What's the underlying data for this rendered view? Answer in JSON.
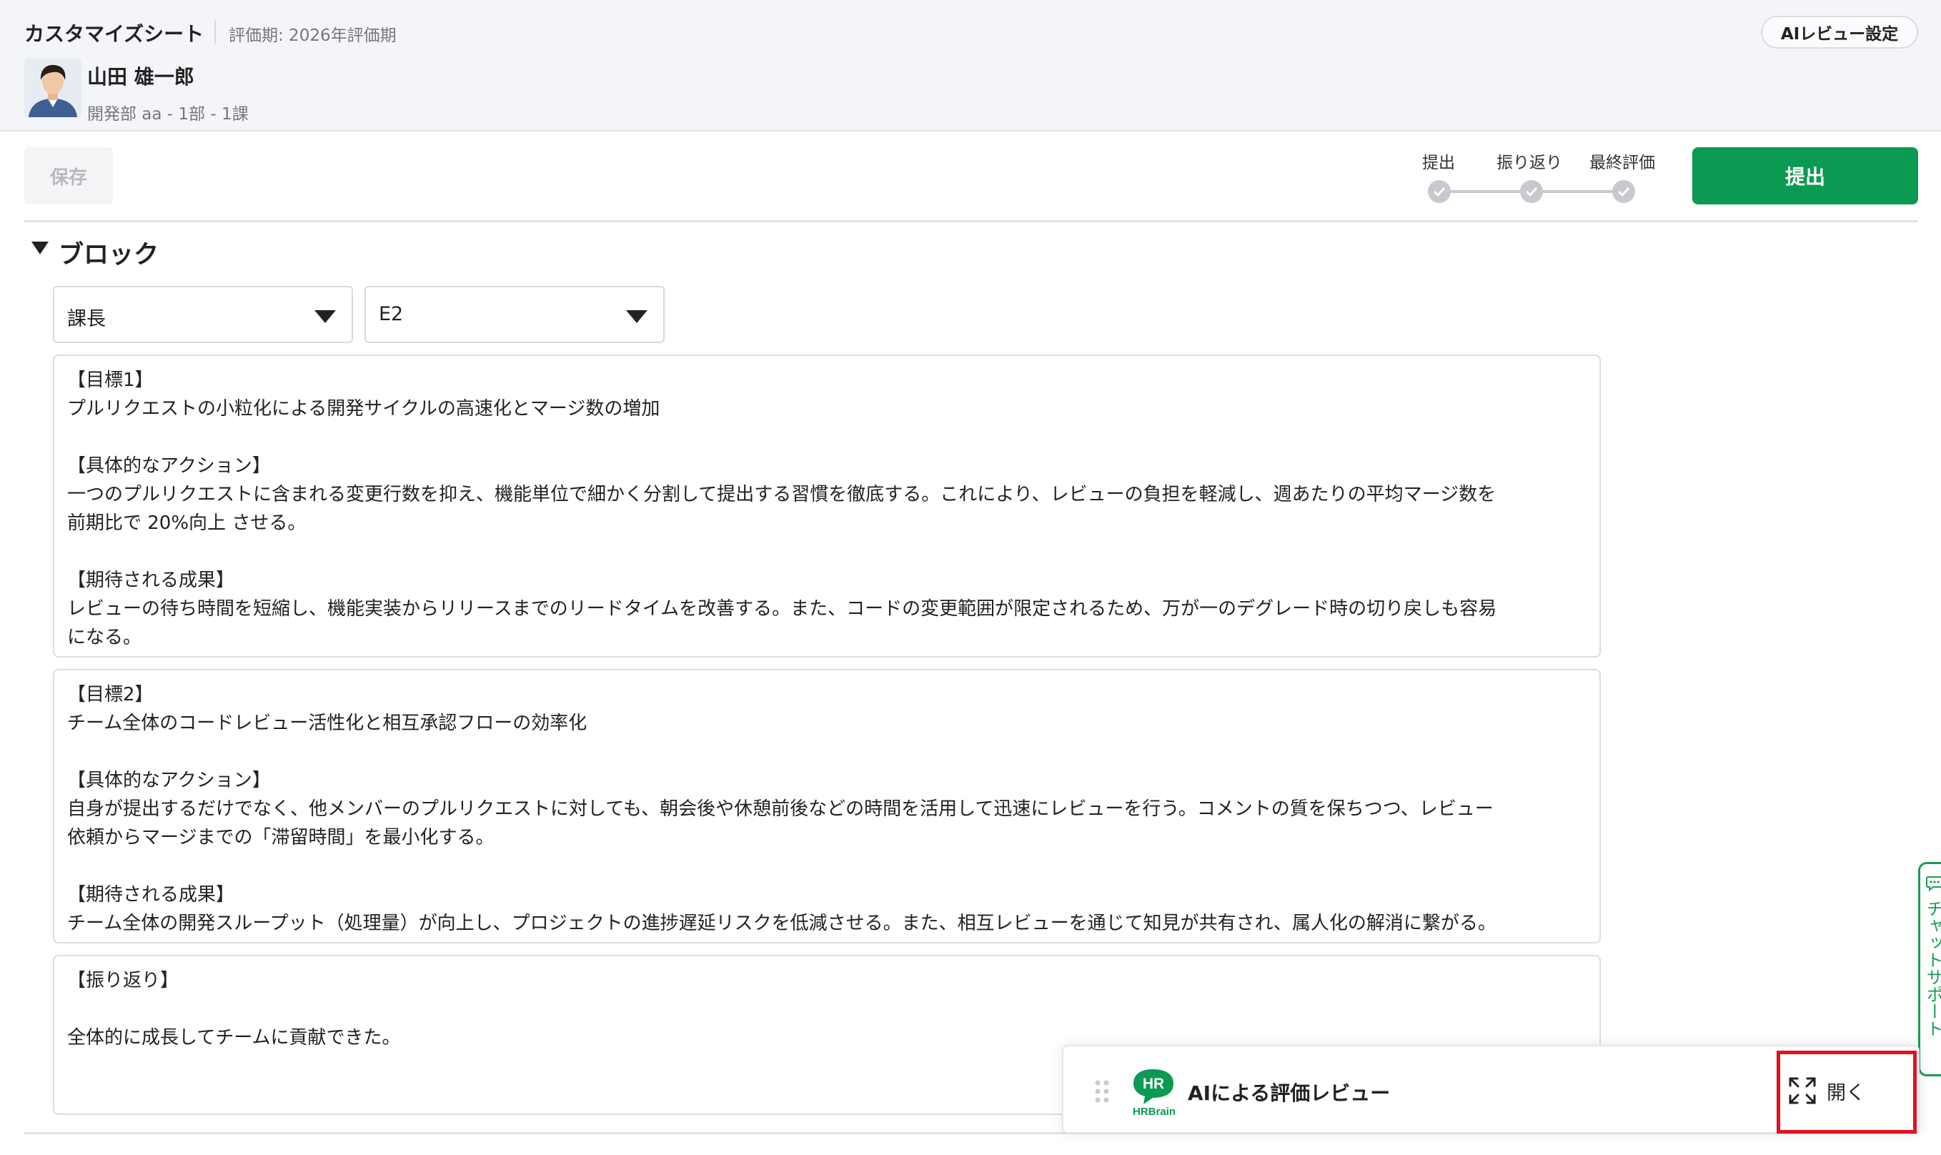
{
  "header": {
    "title": "カスタマイズシート",
    "period": "評価期: 2026年評価期",
    "ai_settings_label": "AIレビュー設定",
    "user": {
      "name": "山田 雄一郎",
      "department": "開発部 aa - 1部 - 1課"
    }
  },
  "toolbar": {
    "save_label": "保存",
    "steps": [
      "提出",
      "振り返り",
      "最終評価"
    ],
    "submit_label": "提出"
  },
  "block": {
    "title": "ブロック",
    "selects": [
      {
        "value": "課長"
      },
      {
        "value": "E2"
      }
    ],
    "goal1": {
      "lines": [
        "【目標1】",
        "プルリクエストの小粒化による開発サイクルの高速化とマージ数の増加",
        "",
        "【具体的なアクション】",
        "一つのプルリクエストに含まれる変更行数を抑え、機能単位で細かく分割して提出する習慣を徹底する。これにより、レビューの負担を軽減し、週あたりの平均マージ数を",
        "前期比で 20%向上 させる。",
        "",
        "【期待される成果】",
        "レビューの待ち時間を短縮し、機能実装からリリースまでのリードタイムを改善する。また、コードの変更範囲が限定されるため、万が一のデグレード時の切り戻しも容易",
        "になる。"
      ]
    },
    "goal2": {
      "lines": [
        "【目標2】",
        "チーム全体のコードレビュー活性化と相互承認フローの効率化",
        "",
        "【具体的なアクション】",
        "自身が提出するだけでなく、他メンバーのプルリクエストに対しても、朝会後や休憩前後などの時間を活用して迅速にレビューを行う。コメントの質を保ちつつ、レビュー",
        "依頼からマージまでの「滞留時間」を最小化する。",
        "",
        "【期待される成果】",
        "チーム全体の開発スループット（処理量）が向上し、プロジェクトの進捗遅延リスクを低減させる。また、相互レビューを通じて知見が共有され、属人化の解消に繋がる。"
      ]
    },
    "reflection": {
      "lines": [
        "【振り返り】",
        "",
        "全体的に成長してチームに貢献できた。"
      ]
    }
  },
  "chat_support": {
    "label": "チャットサポート",
    "icon": "chat-bubble-icon"
  },
  "ai_review": {
    "logo_text": "HR",
    "logo_brand": "HRBrain",
    "title": "AIによる評価レビュー",
    "open_label": "開く",
    "open_icon": "expand-icon"
  },
  "colors": {
    "accent_green": "#0b9a51",
    "highlight_red": "#e3101e",
    "header_bg": "#f4f5f9"
  }
}
